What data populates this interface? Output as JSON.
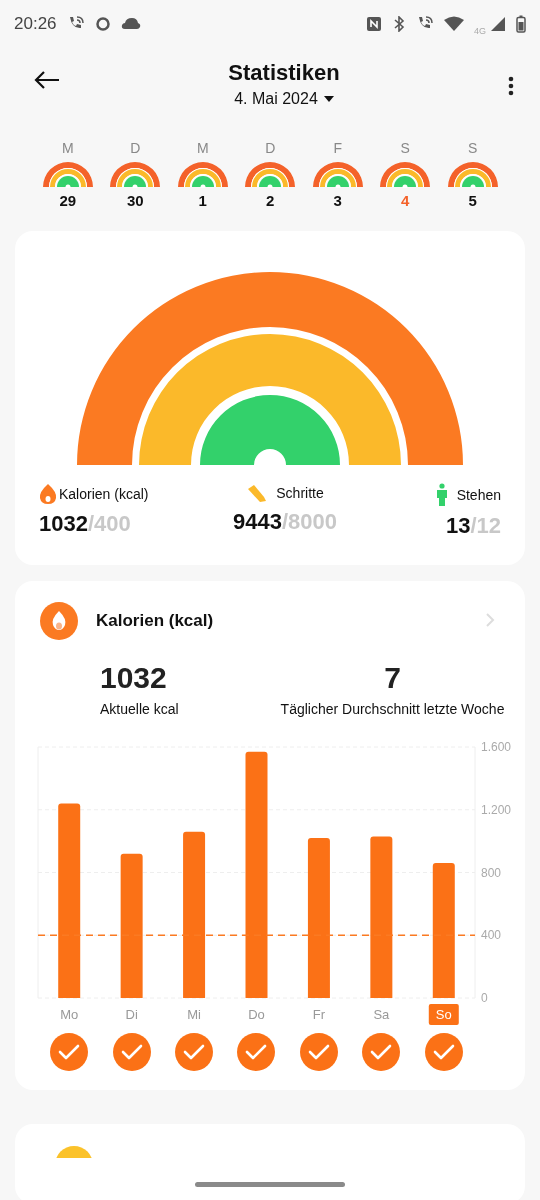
{
  "status_bar": {
    "time": "20:26",
    "network": "4G"
  },
  "header": {
    "title": "Statistiken",
    "date": "4. Mai 2024"
  },
  "week": [
    {
      "weekday": "M",
      "date": "29",
      "selected": false
    },
    {
      "weekday": "D",
      "date": "30",
      "selected": false
    },
    {
      "weekday": "M",
      "date": "1",
      "selected": false
    },
    {
      "weekday": "D",
      "date": "2",
      "selected": false
    },
    {
      "weekday": "F",
      "date": "3",
      "selected": false
    },
    {
      "weekday": "S",
      "date": "4",
      "selected": true
    },
    {
      "weekday": "S",
      "date": "5",
      "selected": false
    }
  ],
  "summary": {
    "metrics": [
      {
        "kind": "calories",
        "label": "Kalorien (kcal)",
        "value": "1032",
        "goal": "/400",
        "color": "#fb7a22"
      },
      {
        "kind": "steps",
        "label": "Schritte",
        "value": "9443",
        "goal": "/8000",
        "color": "#fbb92a"
      },
      {
        "kind": "standing",
        "label": "Stehen",
        "value": "13",
        "goal": "/12",
        "color": "#33d16b"
      }
    ]
  },
  "calories_card": {
    "title": "Kalorien (kcal)",
    "stats": [
      {
        "value": "1032",
        "label": "Aktuelle kcal"
      },
      {
        "value": "7",
        "label": "Täglicher Durchschnitt letzte Woche"
      }
    ],
    "chart_data": {
      "type": "bar",
      "categories": [
        "Mo",
        "Di",
        "Mi",
        "Do",
        "Fr",
        "Sa",
        "So"
      ],
      "values": [
        1240,
        920,
        1060,
        1570,
        1020,
        1030,
        860
      ],
      "ylim": [
        0,
        1600
      ],
      "yticks": [
        0,
        400,
        800,
        {
          "value": 1200,
          "label": "1.200"
        },
        {
          "value": 1600,
          "label": "1.600"
        }
      ],
      "grid": true,
      "ref_lines": [
        {
          "axis": "y",
          "value": 400,
          "color": "#fb7a22"
        }
      ]
    },
    "days": [
      {
        "selected": false,
        "done": true
      },
      {
        "selected": false,
        "done": true
      },
      {
        "selected": false,
        "done": true
      },
      {
        "selected": false,
        "done": true
      },
      {
        "selected": false,
        "done": true
      },
      {
        "selected": false,
        "done": true
      },
      {
        "selected": true,
        "done": true
      }
    ]
  }
}
